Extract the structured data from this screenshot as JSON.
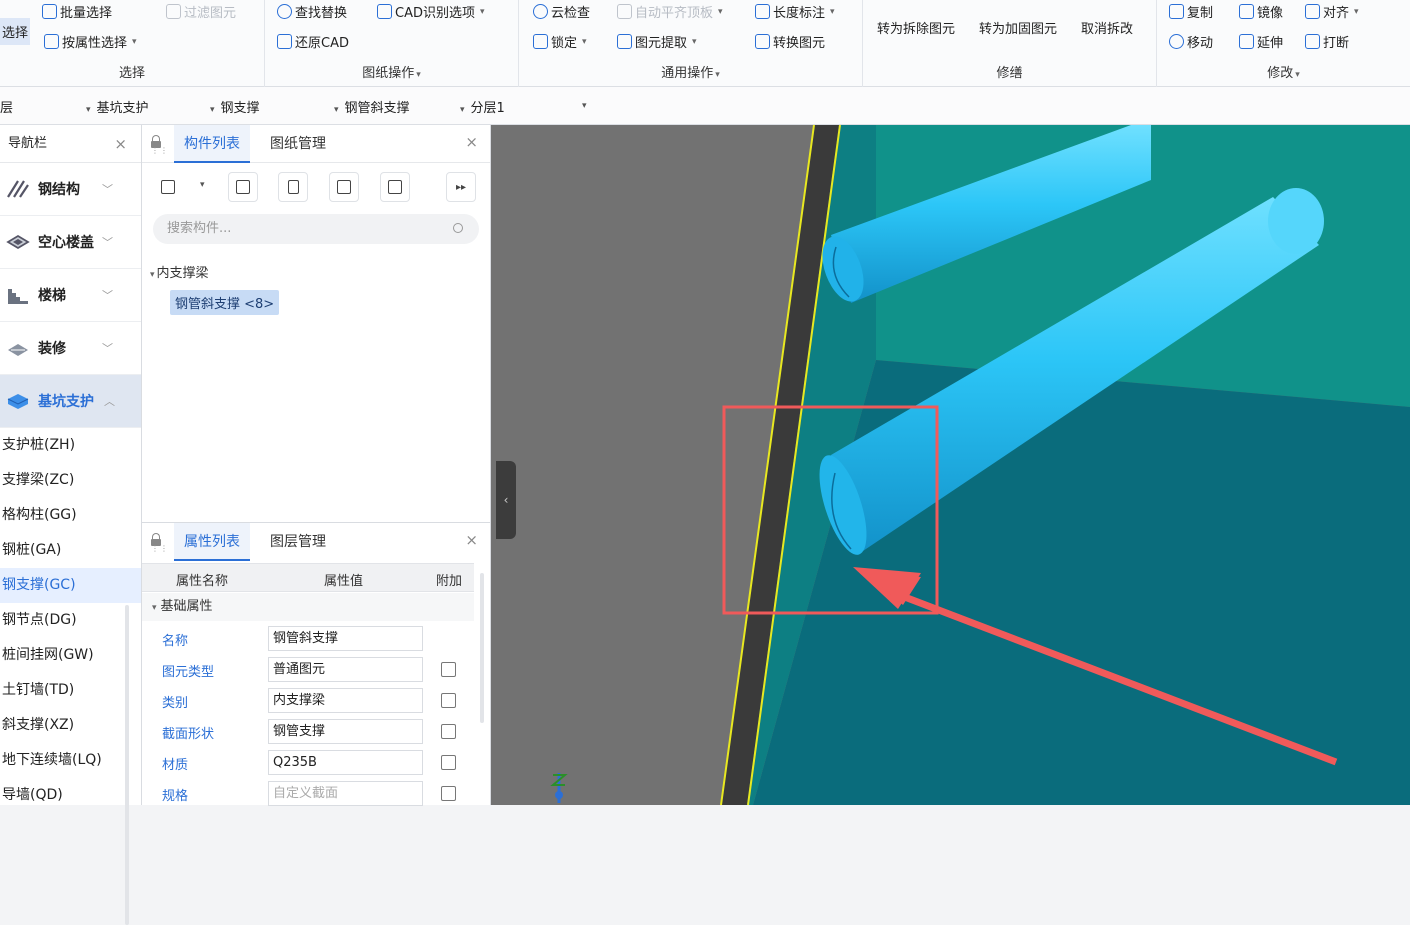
{
  "ribbon": {
    "select": {
      "title": "选择",
      "left_button": "选择",
      "batch_select": "批量选择",
      "filter_elements": "过滤图元",
      "by_attribute": "按属性选择"
    },
    "drawing": {
      "title": "图纸操作",
      "find_replace": "查找替换",
      "cad_options": "CAD识别选项",
      "restore_cad": "还原CAD"
    },
    "common": {
      "title": "通用操作",
      "cloud_check": "云检查",
      "auto_align": "自动平齐顶板",
      "length_dim": "长度标注",
      "lock": "锁定",
      "extract": "图元提取",
      "convert": "转换图元"
    },
    "repair": {
      "title": "修缮",
      "to_remove": "转为拆除图元",
      "to_reinforce": "转为加固图元",
      "cancel": "取消拆改"
    },
    "modify": {
      "title": "修改",
      "copy": "复制",
      "mirror": "镜像",
      "align": "对齐",
      "move": "移动",
      "extend": "延伸",
      "break": "打断"
    }
  },
  "layerbar": {
    "floor": "层",
    "category": "基坑支护",
    "type": "钢支撑",
    "component": "钢管斜支撑",
    "layer": "分层1"
  },
  "nav": {
    "title": "导航栏",
    "categories": [
      {
        "label": "钢结构",
        "icon": "steel-structure-icon",
        "active": false
      },
      {
        "label": "空心楼盖",
        "icon": "hollow-floor-icon",
        "active": false
      },
      {
        "label": "楼梯",
        "icon": "stairs-icon",
        "active": false
      },
      {
        "label": "装修",
        "icon": "decoration-icon",
        "active": false
      },
      {
        "label": "基坑支护",
        "icon": "excavation-support-icon",
        "active": true
      }
    ],
    "items": [
      "支护桩(ZH)",
      "支撑梁(ZC)",
      "格构柱(GG)",
      "钢桩(GA)",
      "钢支撑(GC)",
      "钢节点(DG)",
      "桩间挂网(GW)",
      "土钉墙(TD)",
      "斜支撑(XZ)",
      "地下连续墙(LQ)",
      "导墙(QD)"
    ],
    "active_item": "钢支撑(GC)"
  },
  "component_panel": {
    "tabs": [
      "构件列表",
      "图纸管理"
    ],
    "active_tab": "构件列表",
    "search_placeholder": "搜索构件...",
    "tree": {
      "group": "内支撑梁",
      "item": "钢管斜支撑 <8>"
    }
  },
  "property_panel": {
    "tabs": [
      "属性列表",
      "图层管理"
    ],
    "headers": [
      "属性名称",
      "属性值",
      "附加"
    ],
    "section": "基础属性",
    "rows": [
      {
        "name": "名称",
        "value": "钢管斜支撑",
        "checkbox": false
      },
      {
        "name": "图元类型",
        "value": "普通图元",
        "checkbox": true
      },
      {
        "name": "类别",
        "value": "内支撑梁",
        "checkbox": true
      },
      {
        "name": "截面形状",
        "value": "钢管支撑",
        "checkbox": true
      },
      {
        "name": "材质",
        "value": "Q235B",
        "checkbox": true
      },
      {
        "name": "规格",
        "value": "自定义截面",
        "checkbox": true
      }
    ]
  },
  "colors": {
    "accent": "#2b6fd6",
    "pipe": "#29c4f5",
    "wall": "#10928a",
    "wall_lower": "#0a6c7c",
    "highlight": "#f05a5a"
  }
}
